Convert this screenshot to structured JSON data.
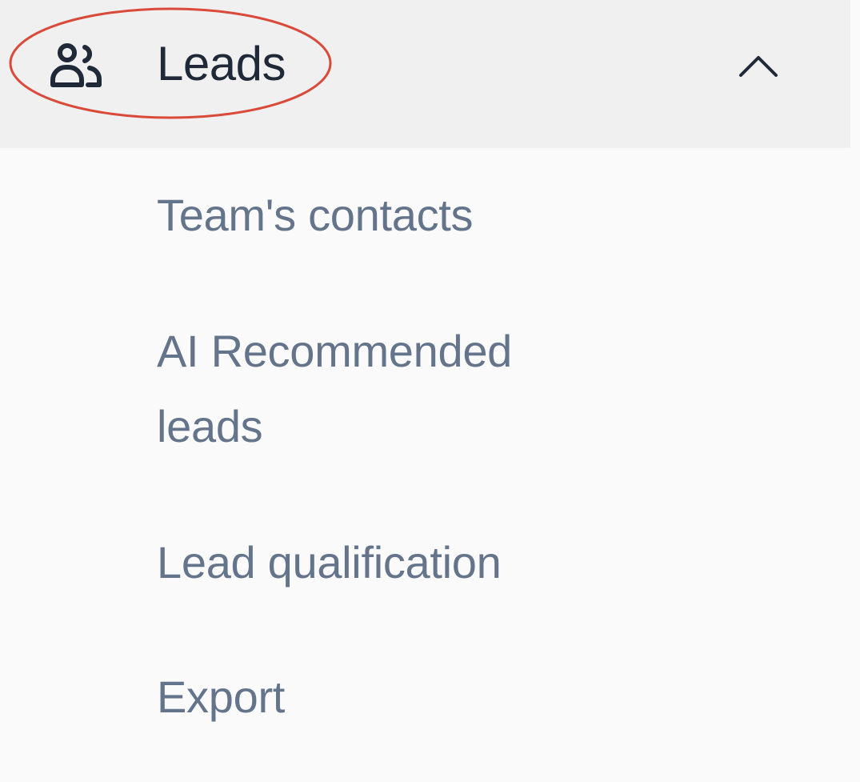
{
  "nav": {
    "section": {
      "label": "Leads",
      "icon": "users-icon",
      "expanded_icon": "chevron-up-icon",
      "highlight_color": "#d94a3a"
    },
    "items": [
      {
        "label": "Team's contacts"
      },
      {
        "label": "AI Recommended leads"
      },
      {
        "label": "Lead qualification"
      },
      {
        "label": "Export"
      }
    ]
  }
}
